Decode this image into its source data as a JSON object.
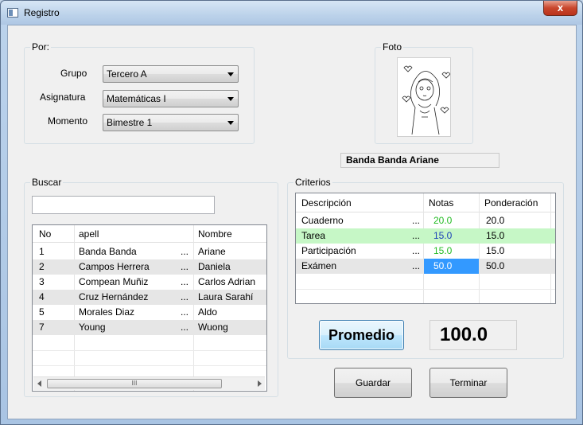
{
  "window": {
    "title": "Registro",
    "close_glyph": "x"
  },
  "por": {
    "legend": "Por:",
    "grupo_label": "Grupo",
    "grupo_value": "Tercero A",
    "asignatura_label": "Asignatura",
    "asignatura_value": "Matemáticas I",
    "momento_label": "Momento",
    "momento_value": "Bimestre 1"
  },
  "foto": {
    "legend": "Foto",
    "student_name": "Banda Banda Ariane"
  },
  "buscar": {
    "legend": "Buscar",
    "search_value": "",
    "columns": [
      "No",
      "apell",
      "Nombre"
    ],
    "rows": [
      {
        "no": "1",
        "apell": "Banda Banda",
        "nombre": "Ariane",
        "more": "..."
      },
      {
        "no": "2",
        "apell": "Campos Herrera",
        "nombre": "Daniela",
        "more": "..."
      },
      {
        "no": "3",
        "apell": "Compean Muñiz",
        "nombre": "Carlos Adrian",
        "more": "..."
      },
      {
        "no": "4",
        "apell": "Cruz Hernández",
        "nombre": "Laura Sarahí",
        "more": "..."
      },
      {
        "no": "5",
        "apell": "Morales Diaz",
        "nombre": "Aldo",
        "more": "..."
      },
      {
        "no": "7",
        "apell": "Young",
        "nombre": "Wuong",
        "more": "..."
      }
    ],
    "scroll_thumb_text": "III"
  },
  "criterios": {
    "legend": "Criterios",
    "columns": [
      "Descripción",
      "Notas",
      "Ponderación"
    ],
    "rows": [
      {
        "descripcion": "Cuaderno",
        "more": "...",
        "notas": "20.0",
        "ponderacion": "20.0"
      },
      {
        "descripcion": "Tarea",
        "more": "...",
        "notas": "15.0",
        "ponderacion": "15.0"
      },
      {
        "descripcion": "Participación",
        "more": "...",
        "notas": "15.0",
        "ponderacion": "15.0"
      },
      {
        "descripcion": "Exámen",
        "more": "...",
        "notas": "50.0",
        "ponderacion": "50.0"
      }
    ]
  },
  "promedio": {
    "button_label": "Promedio",
    "value": "100.0"
  },
  "actions": {
    "guardar_label": "Guardar",
    "terminar_label": "Terminar"
  },
  "colors": {
    "notas_text": "#22bb22",
    "tarea_row_bg": "#c6f7c6",
    "selected_cell_bg": "#3399ff",
    "alt_row_bg": "#e6e6e6"
  }
}
